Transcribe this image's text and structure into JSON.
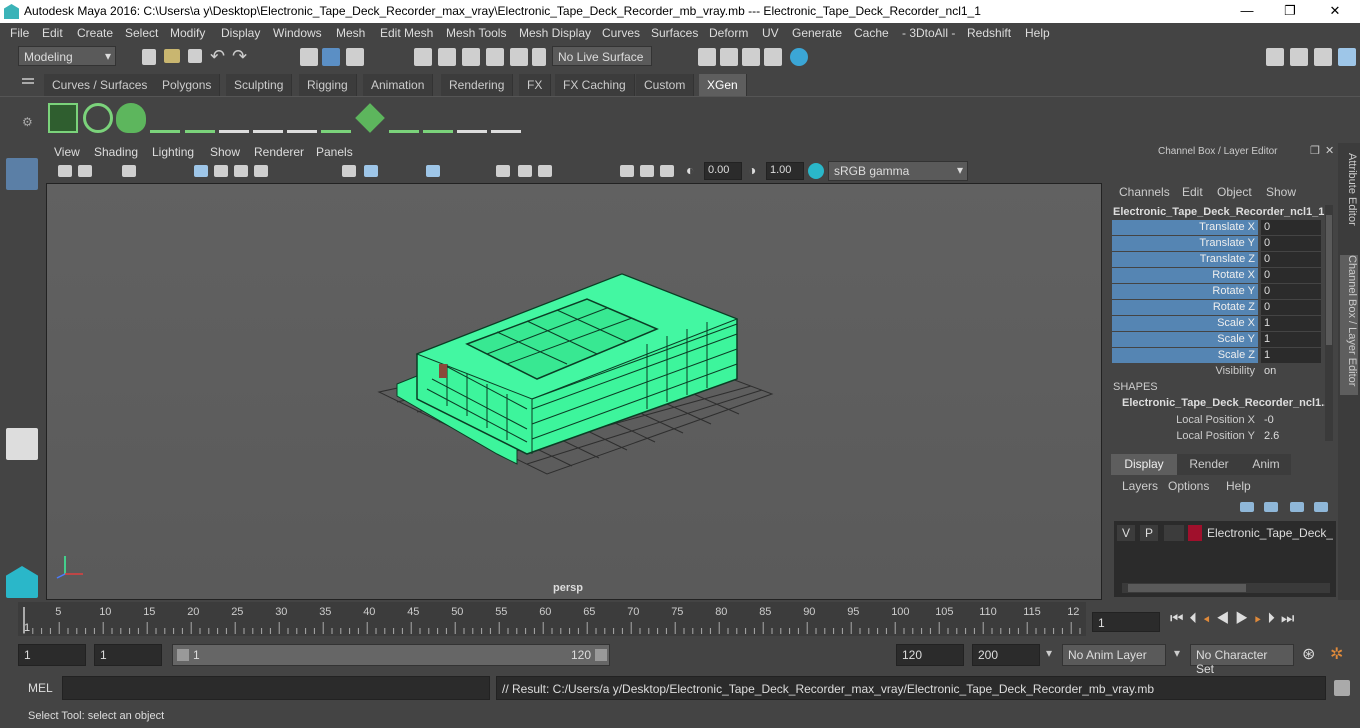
{
  "window": {
    "title": "Autodesk Maya 2016: C:\\Users\\a y\\Desktop\\Electronic_Tape_Deck_Recorder_max_vray\\Electronic_Tape_Deck_Recorder_mb_vray.mb   ---   Electronic_Tape_Deck_Recorder_ncl1_1"
  },
  "menubar": [
    "File",
    "Edit",
    "Create",
    "Select",
    "Modify",
    "Display",
    "Windows",
    "Mesh",
    "Edit Mesh",
    "Mesh Tools",
    "Mesh Display",
    "Curves",
    "Surfaces",
    "Deform",
    "UV",
    "Generate",
    "Cache",
    "- 3DtoAll -",
    "Redshift",
    "Help"
  ],
  "status": {
    "mode": "Modeling",
    "live_surface": "No Live Surface"
  },
  "shelf_tabs": [
    "Curves / Surfaces",
    "Polygons",
    "Sculpting",
    "Rigging",
    "Animation",
    "Rendering",
    "FX",
    "FX Caching",
    "Custom",
    "XGen"
  ],
  "active_shelf": "XGen",
  "panel_menu": [
    "View",
    "Shading",
    "Lighting",
    "Show",
    "Renderer",
    "Panels"
  ],
  "panel_toolbar": {
    "exposure": "0.00",
    "gamma": "1.00",
    "color_space": "sRGB gamma"
  },
  "viewport": {
    "camera": "persp"
  },
  "channel_box": {
    "title": "Channel Box / Layer Editor",
    "menu": [
      "Channels",
      "Edit",
      "Object",
      "Show"
    ],
    "object": "Electronic_Tape_Deck_Recorder_ncl1_1",
    "channels": [
      {
        "name": "Translate X",
        "value": "0"
      },
      {
        "name": "Translate Y",
        "value": "0"
      },
      {
        "name": "Translate Z",
        "value": "0"
      },
      {
        "name": "Rotate X",
        "value": "0"
      },
      {
        "name": "Rotate Y",
        "value": "0"
      },
      {
        "name": "Rotate Z",
        "value": "0"
      },
      {
        "name": "Scale X",
        "value": "1"
      },
      {
        "name": "Scale Y",
        "value": "1"
      },
      {
        "name": "Scale Z",
        "value": "1"
      },
      {
        "name": "Visibility",
        "value": "on"
      }
    ],
    "shapes_header": "SHAPES",
    "shape_name": "Electronic_Tape_Deck_Recorder_ncl1...",
    "shape_channels": [
      {
        "name": "Local Position X",
        "value": "-0"
      },
      {
        "name": "Local Position Y",
        "value": "2.6"
      }
    ]
  },
  "layer_editor": {
    "tabs": [
      "Display",
      "Render",
      "Anim"
    ],
    "menu": [
      "Layers",
      "Options",
      "Help"
    ],
    "layer": {
      "v": "V",
      "p": "P",
      "name": "Electronic_Tape_Deck_Re",
      "color": "#a0102c"
    }
  },
  "side_tabs": [
    "Attribute Editor",
    "Channel Box / Layer Editor"
  ],
  "timeline": {
    "ticks": [
      "5",
      "10",
      "15",
      "20",
      "25",
      "30",
      "35",
      "40",
      "45",
      "50",
      "55",
      "60",
      "65",
      "70",
      "75",
      "80",
      "85",
      "90",
      "95",
      "100",
      "105",
      "110",
      "115",
      "12"
    ],
    "start_marker": "1",
    "current_frame": "1"
  },
  "range": {
    "start": "1",
    "anim_start": "1",
    "slider_start": "1",
    "slider_end": "120",
    "end": "120",
    "anim_end": "200",
    "anim_layer": "No Anim Layer",
    "character_set": "No Character Set"
  },
  "cmdline": {
    "label": "MEL",
    "result": "// Result: C:/Users/a y/Desktop/Electronic_Tape_Deck_Recorder_max_vray/Electronic_Tape_Deck_Recorder_mb_vray.mb"
  },
  "help_line": "Select Tool: select an object",
  "colors": {
    "wireframe": "#3df59c",
    "selected_channel": "#5585b3"
  }
}
